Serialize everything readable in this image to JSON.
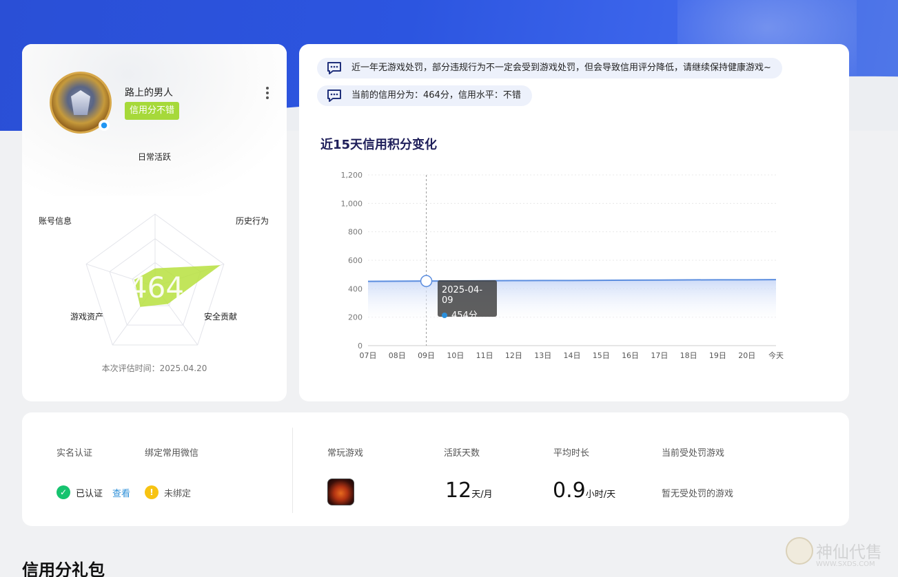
{
  "profile": {
    "nickname": "路上的男人",
    "credit_tag": "信用分不错",
    "score": "464",
    "radar_labels": {
      "daily": "日常活跃",
      "history": "历史行为",
      "security": "安全贡献",
      "assets": "游戏资产",
      "account": "账号信息"
    },
    "radar_values": [
      0.25,
      0.95,
      0.3,
      0.35,
      0.3
    ],
    "eval_time": "本次评估时间：2025.04.20"
  },
  "notices": [
    "近一年无游戏处罚，部分违规行为不一定会受到游戏处罚，但会导致信用评分降低，请继续保持健康游戏~",
    "当前的信用分为：464分，信用水平：不错"
  ],
  "chart_data": {
    "type": "area",
    "title": "近15天信用积分变化",
    "categories": [
      "07日",
      "08日",
      "09日",
      "10日",
      "11日",
      "12日",
      "13日",
      "14日",
      "15日",
      "16日",
      "17日",
      "18日",
      "19日",
      "20日",
      "今天"
    ],
    "series": [
      {
        "values": [
          452,
          453,
          454,
          455,
          456,
          457,
          458,
          458,
          459,
          460,
          461,
          462,
          463,
          463,
          464
        ]
      }
    ],
    "y_ticks": [
      "0",
      "200",
      "400",
      "600",
      "800",
      "1,000",
      "1,200"
    ],
    "ylim": [
      0,
      1200
    ],
    "grid": true,
    "tooltip": {
      "date": "2025-04-09",
      "value_label": "454分",
      "index": 2
    }
  },
  "info": {
    "real_name_label": "实名认证",
    "wechat_label": "绑定常用微信",
    "real_name_status": "已认证",
    "view_link": "查看",
    "wechat_status": "未绑定",
    "frequent_games_label": "常玩游戏",
    "active_days_label": "活跃天数",
    "active_days_value": "12",
    "active_days_unit": "天/月",
    "avg_time_label": "平均时长",
    "avg_time_value": "0.9",
    "avg_time_unit": "小时/天",
    "penalty_label": "当前受处罚游戏",
    "penalty_value": "暂无受处罚的游戏"
  },
  "section_title": "信用分礼包",
  "watermark": {
    "text": "神仙代售",
    "url": "WWW.SXDS.COM"
  },
  "colors": {
    "accent_blue": "#2c55e0",
    "tag_green": "#a6d93a",
    "ok_green": "#16c36f",
    "warn_yellow": "#f7c312",
    "line_blue": "#5b8ddf"
  }
}
